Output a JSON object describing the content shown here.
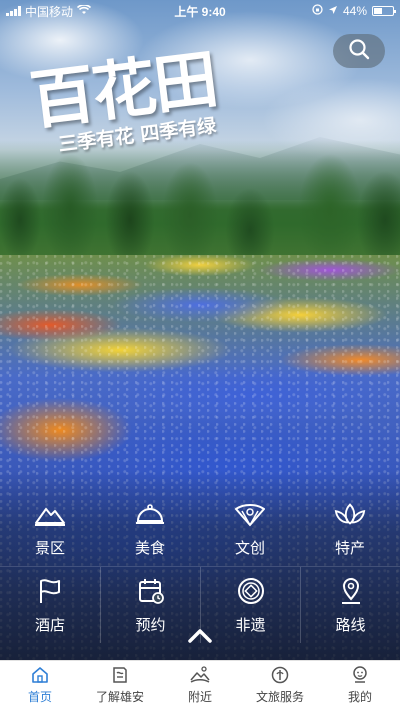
{
  "status_bar": {
    "carrier": "中国移动",
    "time": "上午 9:40",
    "battery_percent": "44%",
    "battery_level": 0.44
  },
  "hero": {
    "title": "百花田",
    "subtitle": "三季有花 四季有绿"
  },
  "search": {
    "icon": "search-icon"
  },
  "categories": {
    "row1": [
      {
        "label": "景区",
        "icon": "mountain-icon"
      },
      {
        "label": "美食",
        "icon": "food-dome-icon"
      },
      {
        "label": "文创",
        "icon": "fan-icon"
      },
      {
        "label": "特产",
        "icon": "lotus-icon"
      }
    ],
    "row2": [
      {
        "label": "酒店",
        "icon": "flag-icon"
      },
      {
        "label": "预约",
        "icon": "calendar-icon"
      },
      {
        "label": "非遗",
        "icon": "coin-pattern-icon"
      },
      {
        "label": "路线",
        "icon": "location-pin-icon"
      }
    ]
  },
  "tab_bar": {
    "tabs": [
      {
        "label": "首页",
        "icon": "home-icon",
        "active": true
      },
      {
        "label": "了解雄安",
        "icon": "book-icon",
        "active": false
      },
      {
        "label": "附近",
        "icon": "nearby-icon",
        "active": false
      },
      {
        "label": "文旅服务",
        "icon": "service-icon",
        "active": false
      },
      {
        "label": "我的",
        "icon": "profile-icon",
        "active": false
      }
    ]
  },
  "colors": {
    "accent": "#2f7fd6",
    "tab_text": "#444444"
  }
}
